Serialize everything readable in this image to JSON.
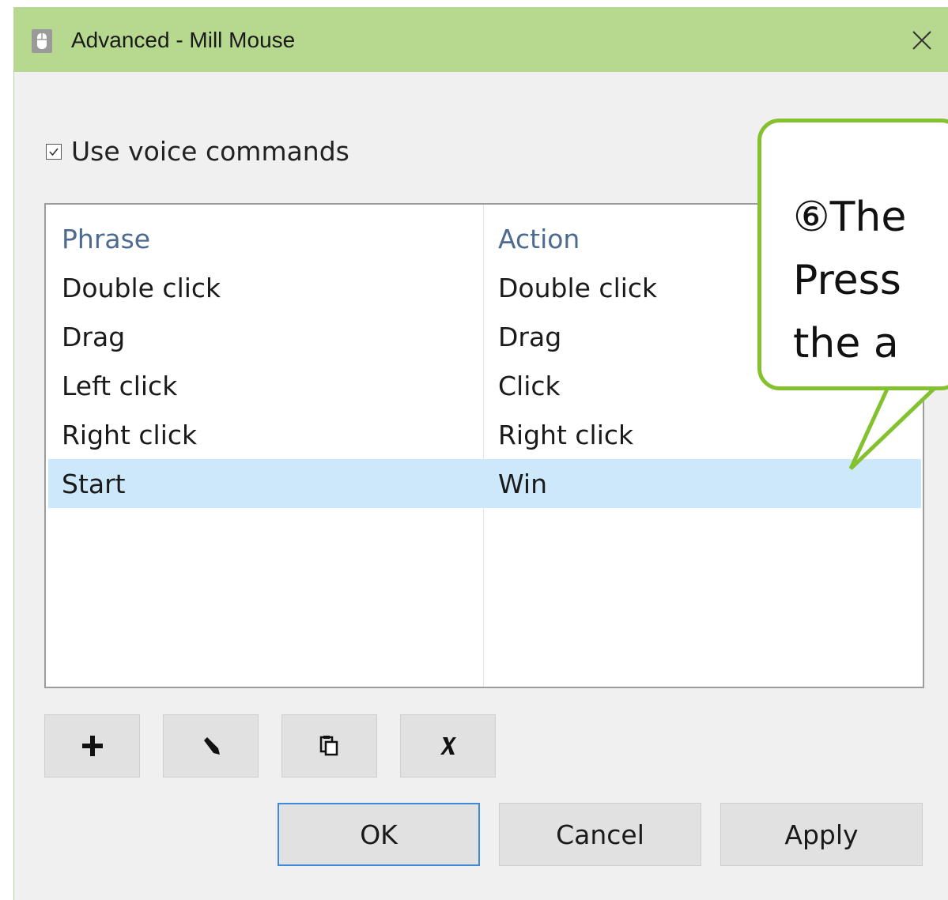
{
  "window": {
    "title": "Advanced - Mill Mouse",
    "titlebar_color": "#b7d98f"
  },
  "voice": {
    "checkbox_label": "Use voice commands",
    "checked": true
  },
  "table": {
    "headers": [
      "Phrase",
      "Action"
    ],
    "rows": [
      {
        "phrase": "Double click",
        "action": "Double click"
      },
      {
        "phrase": "Drag",
        "action": "Drag"
      },
      {
        "phrase": "Left click",
        "action": "Click"
      },
      {
        "phrase": "Right click",
        "action": "Right click"
      },
      {
        "phrase": "Start",
        "action": "Win"
      }
    ],
    "selected_row": 4,
    "selection_color": "#cce8fa"
  },
  "toolbar": {
    "buttons": [
      {
        "name": "add",
        "icon": "plus-icon"
      },
      {
        "name": "edit",
        "icon": "pencil-icon"
      },
      {
        "name": "copy",
        "icon": "copy-icon"
      },
      {
        "name": "delete",
        "icon": "x-icon"
      }
    ]
  },
  "dialog_buttons": {
    "ok": "OK",
    "cancel": "Cancel",
    "apply": "Apply"
  },
  "callout": {
    "line1": "⑥The",
    "line2": "Press",
    "line3": "the a",
    "border_color": "#84c12f"
  }
}
